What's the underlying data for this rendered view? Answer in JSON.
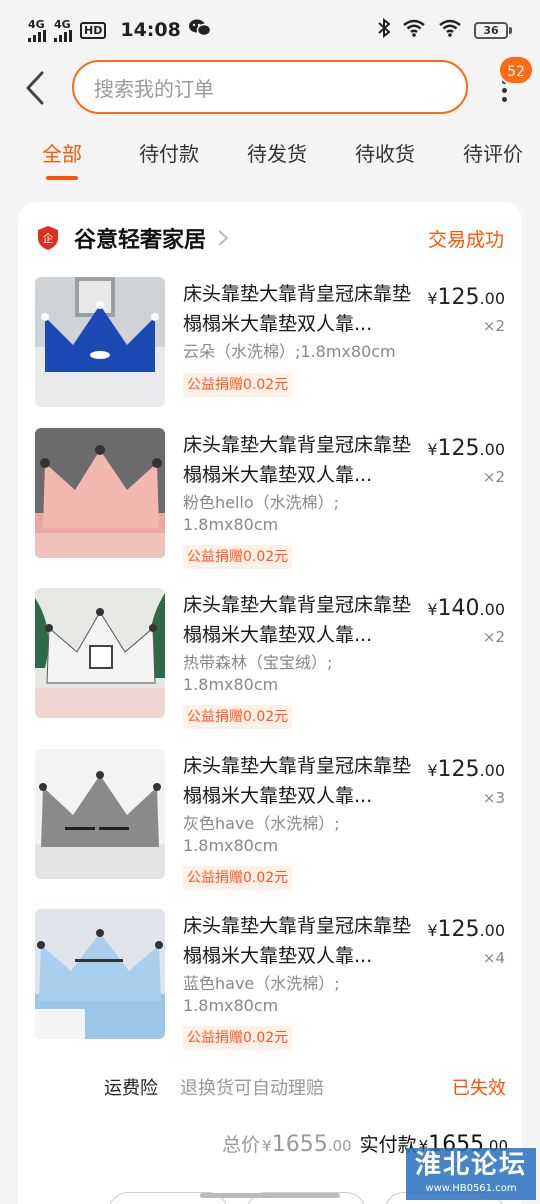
{
  "status_bar": {
    "signal1": "4G",
    "signal2": "4G",
    "hd": "HD",
    "time": "14:08",
    "battery": "36"
  },
  "header": {
    "search_placeholder": "搜索我的订单",
    "badge_count": "52"
  },
  "tabs": [
    {
      "label": "全部",
      "active": true
    },
    {
      "label": "待付款",
      "active": false
    },
    {
      "label": "待发货",
      "active": false
    },
    {
      "label": "待收货",
      "active": false
    },
    {
      "label": "待评价",
      "active": false
    }
  ],
  "order": {
    "shop_name": "谷意轻奢家居",
    "status": "交易成功",
    "items": [
      {
        "title": "床头靠垫大靠背皇冠床靠垫榻榻米大靠垫双人靠...",
        "spec": "云朵（水洗棉）;1.8mx80cm",
        "charity": "公益捐赠0.02元",
        "currency": "¥",
        "price_int": "125",
        "price_dec": ".00",
        "qty": "×2"
      },
      {
        "title": "床头靠垫大靠背皇冠床靠垫榻榻米大靠垫双人靠...",
        "spec": "粉色hello（水洗棉）;\n1.8mx80cm",
        "charity": "公益捐赠0.02元",
        "currency": "¥",
        "price_int": "125",
        "price_dec": ".00",
        "qty": "×2"
      },
      {
        "title": "床头靠垫大靠背皇冠床靠垫榻榻米大靠垫双人靠...",
        "spec": "热带森林（宝宝绒）;\n1.8mx80cm",
        "charity": "公益捐赠0.02元",
        "currency": "¥",
        "price_int": "140",
        "price_dec": ".00",
        "qty": "×2"
      },
      {
        "title": "床头靠垫大靠背皇冠床靠垫榻榻米大靠垫双人靠...",
        "spec": "灰色have（水洗棉）;\n1.8mx80cm",
        "charity": "公益捐赠0.02元",
        "currency": "¥",
        "price_int": "125",
        "price_dec": ".00",
        "qty": "×3"
      },
      {
        "title": "床头靠垫大靠背皇冠床靠垫榻榻米大靠垫双人靠...",
        "spec": "蓝色have（水洗棉）;\n1.8mx80cm",
        "charity": "公益捐赠0.02元",
        "currency": "¥",
        "price_int": "125",
        "price_dec": ".00",
        "qty": "×4"
      }
    ],
    "freight_label": "运费险",
    "freight_desc": "退换货可自动理赔",
    "freight_status": "已失效",
    "total_label": "总价",
    "total_currency": "¥",
    "total_int": "1655",
    "total_dec": ".00",
    "paid_label": "实付款",
    "paid_currency": "¥",
    "paid_int": "1655",
    "paid_dec": ".00"
  },
  "watermark": {
    "title": "淮北论坛",
    "url": "www.HB0561.com"
  },
  "colors": {
    "accent": "#ff5500",
    "search_border": "#ff6a14",
    "charity_bg": "#fff0e8"
  }
}
